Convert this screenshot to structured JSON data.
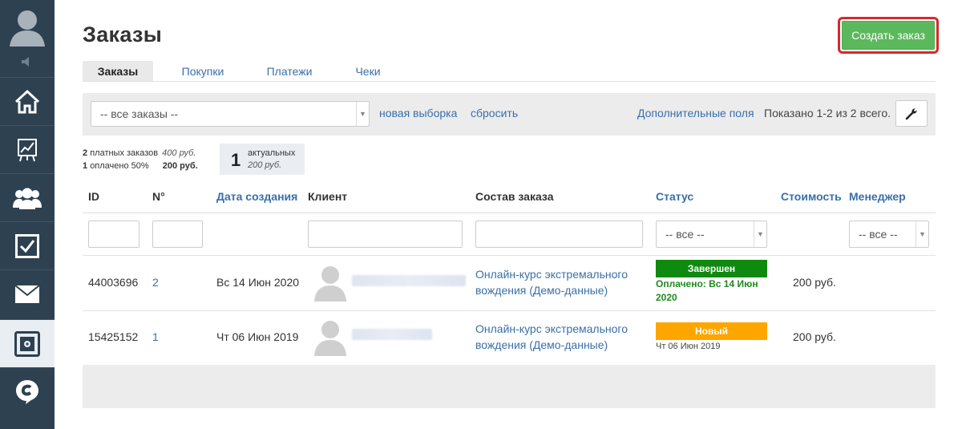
{
  "sidebar": {
    "items": [
      {
        "icon": "home-icon"
      },
      {
        "icon": "chart-icon"
      },
      {
        "icon": "users-icon"
      },
      {
        "icon": "tasks-icon"
      },
      {
        "icon": "mail-icon"
      },
      {
        "icon": "sales-icon",
        "active": true
      },
      {
        "icon": "chat-icon"
      }
    ]
  },
  "header": {
    "title": "Заказы",
    "create_button": "Создать заказ"
  },
  "tabs": [
    {
      "label": "Заказы",
      "active": true
    },
    {
      "label": "Покупки"
    },
    {
      "label": "Платежи"
    },
    {
      "label": "Чеки"
    }
  ],
  "filterbar": {
    "select_value": "-- все заказы --",
    "new_selection": "новая выборка",
    "reset": "сбросить",
    "extra_fields": "Дополнительные поля",
    "shown": "Показано 1-2 из 2 всего."
  },
  "stats": {
    "paid_count": "2",
    "paid_label": "платных заказов",
    "paid_sum": "400 руб.",
    "paid_ratio_count": "1",
    "paid_ratio_label": "оплачено 50%",
    "paid_ratio_sum": "200 руб.",
    "actual_count": "1",
    "actual_label": "актуальных",
    "actual_sum": "200 руб."
  },
  "table": {
    "columns": {
      "id": "ID",
      "num": "N°",
      "created": "Дата создания",
      "client": "Клиент",
      "items": "Состав заказа",
      "status": "Статус",
      "cost": "Стоимость",
      "manager": "Менеджер"
    },
    "filters": {
      "status_select": "-- все --",
      "manager_select": "-- все --"
    },
    "rows": [
      {
        "id": "44003696",
        "num": "2",
        "created": "Вс 14 Июн 2020",
        "product_line1": "Онлайн-курс экстремального",
        "product_line2": "вождения (Демо-данные)",
        "status": "Завершен",
        "status_color": "#0f8a0f",
        "status_note_line1": "Оплачено: Вс 14 Июн",
        "status_note_line2": "2020",
        "cost": "200 руб."
      },
      {
        "id": "15425152",
        "num": "1",
        "created": "Чт 06 Июн 2019",
        "product_line1": "Онлайн-курс экстремального",
        "product_line2": "вождения (Демо-данные)",
        "status": "Новый",
        "status_color": "#ffa500",
        "status_note": "Чт 06 Июн 2019",
        "cost": "200 руб."
      }
    ]
  }
}
